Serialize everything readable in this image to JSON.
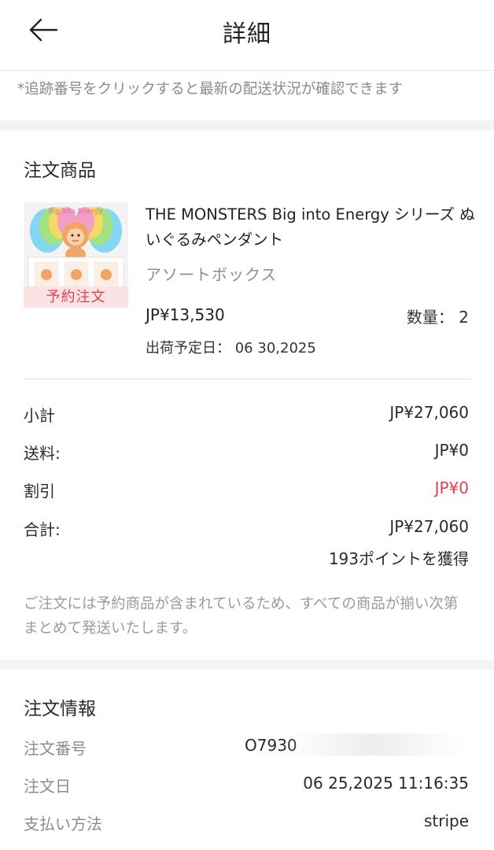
{
  "header": {
    "title": "詳細",
    "back_icon": "arrow-left-icon"
  },
  "notice": {
    "text": "*追跡番号をクリックすると最新の配送状況が確認できます"
  },
  "order_items": {
    "section_title": "注文商品",
    "product": {
      "name": "THE MONSTERS Big into Energy シリーズ ぬいぐるみペンダント",
      "variant": "アソートボックス",
      "badge": "予約注文",
      "price": "JP¥13,530",
      "quantity_label": "数量：",
      "quantity_value": "2",
      "ship_date_label": "出荷予定日：",
      "ship_date_value": "06 30,2025"
    }
  },
  "summary": {
    "subtotal_label": "小計",
    "subtotal_value": "JP¥27,060",
    "shipping_label": "送料:",
    "shipping_value": "JP¥0",
    "discount_label": "割引",
    "discount_value": "JP¥0",
    "total_label": "合計:",
    "total_value": "JP¥27,060",
    "points": "193ポイントを獲得",
    "note": "ご注文には予約商品が含まれているため、すべての商品が揃い次第まとめて発送いたします。"
  },
  "order_info": {
    "section_title": "注文情報",
    "order_number_label": "注文番号",
    "order_number_value": "O7930",
    "order_date_label": "注文日",
    "order_date_value": "06 25,2025 11:16:35",
    "payment_label": "支払い方法",
    "payment_value": "stripe"
  },
  "colors": {
    "accent_red": "#e0414b",
    "badge_bg": "#fbe3e3",
    "separator": "#f4f4f4",
    "muted_text": "#8c8c8c"
  }
}
